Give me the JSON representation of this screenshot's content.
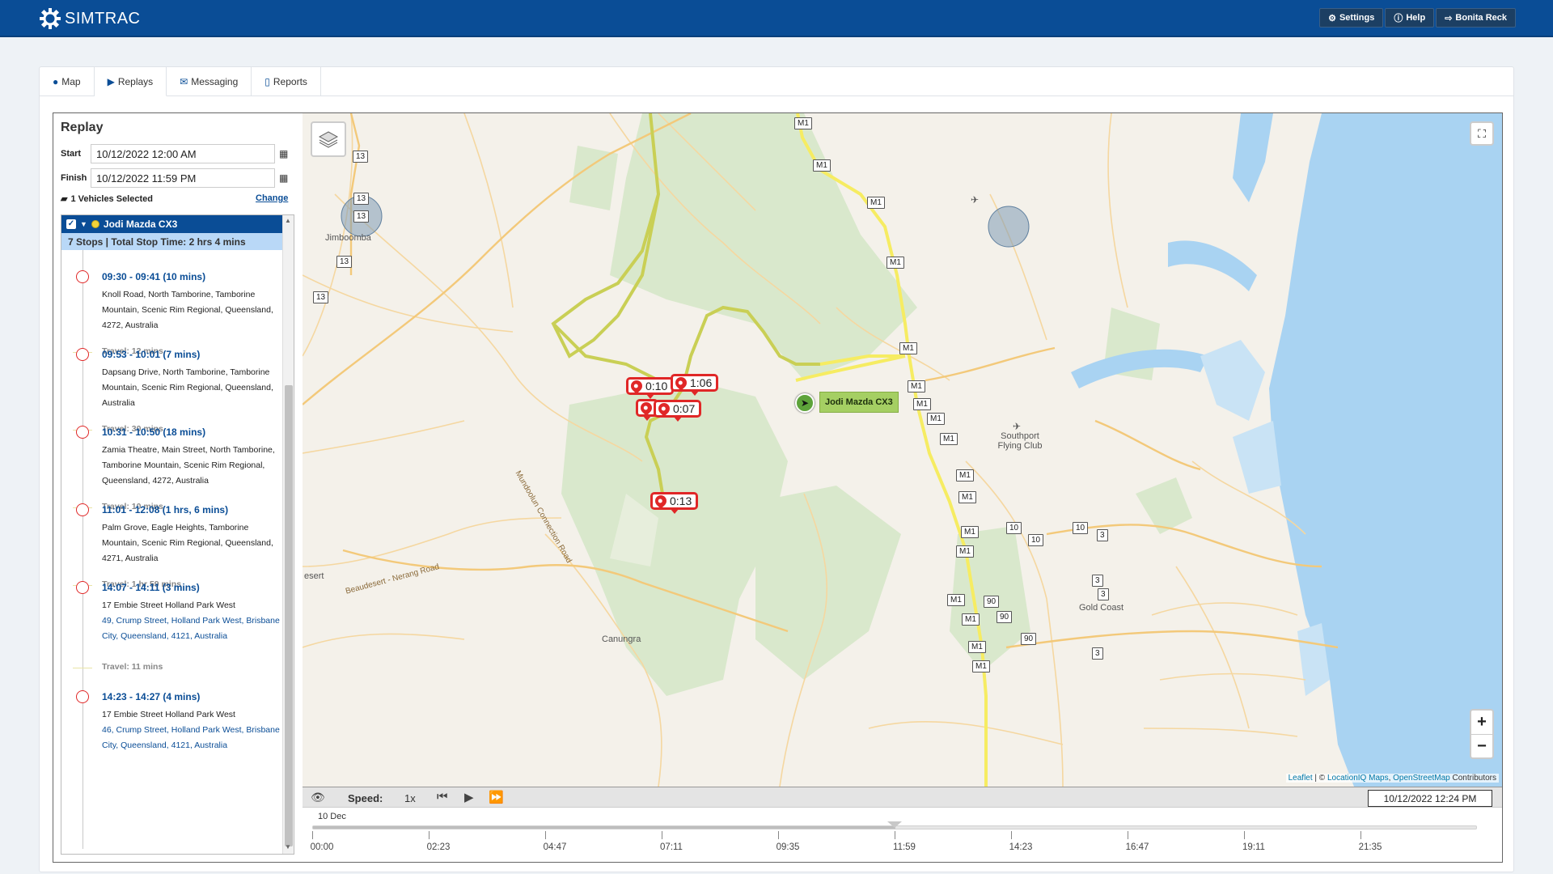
{
  "brand": {
    "name": "SIMTRAC"
  },
  "top_actions": [
    {
      "label": "Settings",
      "icon": "gear-icon"
    },
    {
      "label": "Help",
      "icon": "info-icon"
    },
    {
      "label": "Bonita Reck",
      "icon": "sign-out-icon"
    }
  ],
  "tabs": [
    {
      "label": "Map",
      "icon": "globe-icon"
    },
    {
      "label": "Replays",
      "icon": "play-circle-icon",
      "active": true
    },
    {
      "label": "Messaging",
      "icon": "envelope-icon"
    },
    {
      "label": "Reports",
      "icon": "file-icon"
    }
  ],
  "replay": {
    "title": "Replay",
    "start_label": "Start",
    "start_value": "10/12/2022 12:00 AM",
    "finish_label": "Finish",
    "finish_value": "10/12/2022 11:59 PM",
    "vehicles_selected": "1 Vehicles Selected",
    "change_label": "Change",
    "vehicle_name": "Jodi Mazda CX3",
    "stops_summary": "7 Stops | Total Stop Time: 2 hrs 4 mins",
    "stops": [
      {
        "time": "09:30 - 09:41 (10 mins)",
        "address": "Knoll Road, North Tamborine, Tamborine Mountain, Scenic Rim Regional, Queensland, 4272, Australia",
        "travel": "Travel: 12 mins"
      },
      {
        "time": "09:53 - 10:01 (7 mins)",
        "address": "Dapsang Drive, North Tamborine, Tamborine Mountain, Scenic Rim Regional, Queensland, Australia",
        "travel": "Travel: 30 mins"
      },
      {
        "time": "10:31 - 10:50 (18 mins)",
        "address": "Zamia Theatre, Main Street, North Tamborine, Tamborine Mountain, Scenic Rim Regional, Queensland, 4272, Australia",
        "travel": "Travel: 10 mins"
      },
      {
        "time": "11:01 - 12:08 (1 hrs, 6 mins)",
        "address": "Palm Grove, Eagle Heights, Tamborine Mountain, Scenic Rim Regional, Queensland, 4271, Australia",
        "travel": "Travel: 1 hr 59 mins"
      },
      {
        "time": "14:07 - 14:11 (3 mins)",
        "address_line1": "17 Embie Street Holland Park West",
        "address": "49, Crump Street, Holland Park West, Brisbane City, Queensland, 4121, Australia",
        "travel": "Travel: 11 mins"
      },
      {
        "time": "14:23 - 14:27 (4 mins)",
        "address_line1": "17 Embie Street Holland Park West",
        "address": "46, Crump Street, Holland Park West, Brisbane City, Queensland, 4121, Australia"
      }
    ]
  },
  "map": {
    "vehicle_label": "Jodi Mazda CX3",
    "stop_markers": [
      "0:10",
      "1:06",
      "0:07",
      "0:13"
    ],
    "places": [
      "Jimboomba",
      "Southport Flying Club",
      "Gold Coast",
      "Canungra",
      "esert"
    ],
    "roads": [
      "Mundoolun Connection Road",
      "Beaudesert - Nerang Road"
    ],
    "shields": [
      "M1",
      "13",
      "10",
      "3",
      "90"
    ],
    "attribution": {
      "leaflet": "Leaflet",
      "sep": " | © ",
      "liq": "LocationIQ Maps",
      "comma": ", ",
      "osm": "OpenStreetMap",
      "suffix": " Contributors"
    },
    "zoom_in": "+",
    "zoom_out": "−"
  },
  "playback": {
    "speed_label": "Speed:",
    "speed_value": "1x",
    "current_time": "10/12/2022 12:24 PM",
    "day_label": "10 Dec",
    "position_fraction": 0.5,
    "ticks": [
      "00:00",
      "02:23",
      "04:47",
      "07:11",
      "09:35",
      "11:59",
      "14:23",
      "16:47",
      "19:11",
      "21:35"
    ]
  },
  "colors": {
    "brand": "#0a4d96",
    "stop": "#e02727",
    "route": "#c9cf55",
    "highway": "#f6ec62",
    "water": "#a9d3f2",
    "park": "#d9e8cc"
  }
}
